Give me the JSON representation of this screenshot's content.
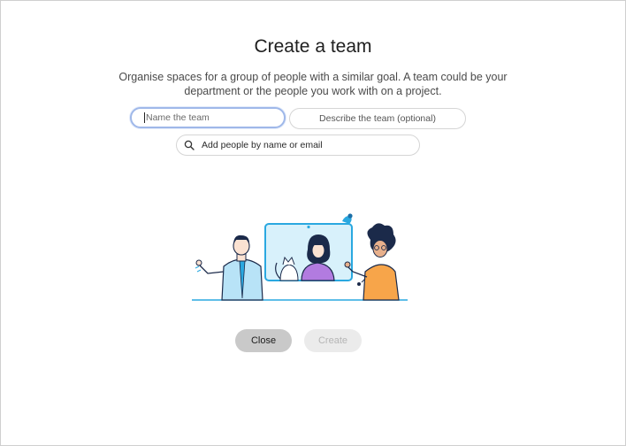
{
  "dialog": {
    "title": "Create a team",
    "subtitle": "Organise spaces for a group of people with a similar goal. A team could be your department or the people you work with on a project."
  },
  "form": {
    "name_placeholder": "Name the team",
    "description_placeholder": "Describe the team (optional)",
    "people_placeholder": "Add people by name or email"
  },
  "buttons": {
    "close_label": "Close",
    "create_label": "Create"
  },
  "icons": {
    "search": "search-icon"
  },
  "colors": {
    "focus_ring": "#9fb8e9",
    "close_bg": "#c9c9c9",
    "create_disabled_bg": "#ebebeb",
    "illustration_blue": "#2aa8e0"
  }
}
